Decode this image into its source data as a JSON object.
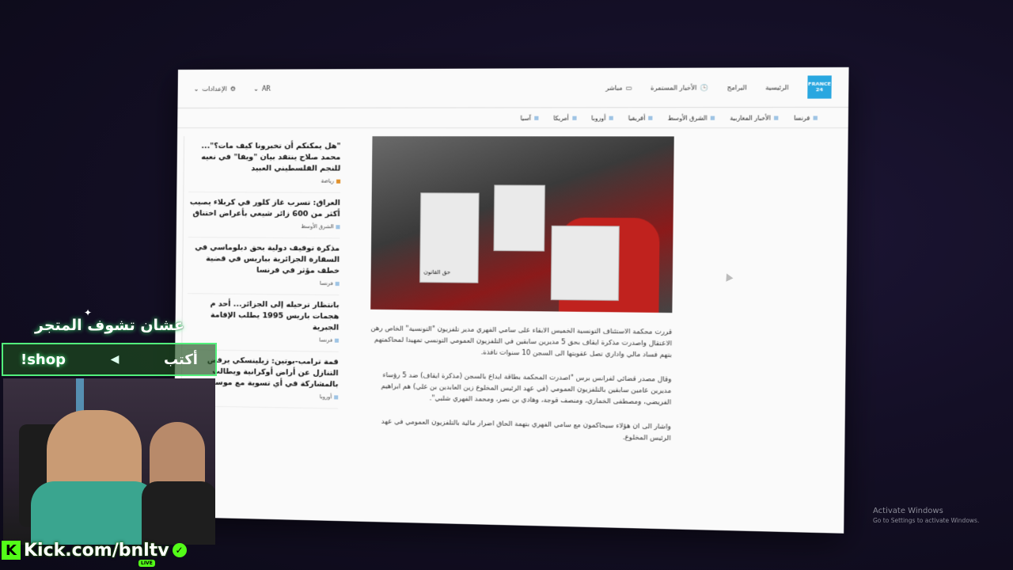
{
  "browser": {
    "header": {
      "logo_text": "FRANCE 24",
      "nav_top": [
        "الرئيسية",
        "البرامج",
        "الأخبار المستمرة",
        "مباشر"
      ],
      "lang": "AR",
      "settings_label": "الإعدادات"
    },
    "nav_sections": [
      "فرنسا",
      "الأخبار المغاربية",
      "الشرق الأوسط",
      "أفريقيا",
      "أوروبا",
      "أمريكا",
      "آسيا"
    ],
    "sidebar": [
      {
        "title": "\"هل يمكنكم أن تخبرونا كيف مات؟\"... محمد صلاح ينتقد بيان \"ويفا\" في نعيه للنجم الفلسطيني العبيد",
        "category": "رياضة"
      },
      {
        "title": "العراق: تسرب غاز كلور في كربلاء يصيب أكثر من 600 زائر شيعي بأعراض اختناق",
        "category": "الشرق الأوسط"
      },
      {
        "title": "مذكرة توقيف دولية بحق دبلوماسي في السفارة الجزائرية بباريس في قضية خطف مؤثر في فرنسا",
        "category": "فرنسا"
      },
      {
        "title": "بانتظار ترحيله إلى الجزائر... أحد م هجمات باريس 1995 يطلب الإقامة الجبرية",
        "category": "فرنسا"
      },
      {
        "title": "قمة ترامب-بوتين: زيلينسكي يرفض التنازل عن أراض أوكرانية ويطالب بالمشاركة في أي تسوية مع موسك",
        "category": "أوروبا"
      }
    ],
    "article": {
      "photo_sign_text": "حق القانون",
      "paragraphs": [
        "قررت محكمة الاستئناف التونسية الخميس الابقاء على سامي الفهري مدير تلفزيون \"التونسية\" الخاص رهن الاعتقال واصدرت مذكرة ايقاف بحق 5 مديرين سابقين في التلفزيون العمومي التونسي تمهيدا لمحاكمتهم بتهم فساد مالي واداري تصل عقوبتها الى السجن 10 سنوات نافذة.",
        "وقال مصدر قضائي لفرانس برس \"اصدرت المحكمة بطاقة ايداع بالسجن (مذكرة ايقاف) ضد 5 رؤساء مديرين عامين سابقين بالتلفزيون العمومي (في عهد الرئيس المخلوع زين العابدين بن علي) هم ابراهيم الفريضي، ومصطفى الخماري، ومنصف قوجة، وهادي بن نصر، ومحمد الفهري شلبي\".",
        "واشار الى ان هؤلاء سيحاكمون مع سامي الفهري بتهمة الحاق اضرار مالية بالتلفزيون العمومي في عهد الرئيس المخلوع."
      ]
    }
  },
  "stream_overlay": {
    "prompt_text": "عشان تشوف المتجر",
    "verb": "أكتب",
    "command": "!shop",
    "kick_url": "Kick.com/bnltv",
    "live_badge": "LIVE"
  },
  "windows_watermark": {
    "line1": "Activate Windows",
    "line2": "Go to Settings to activate Windows."
  },
  "colors": {
    "accent_green": "#53fc18",
    "france24_blue": "#29a7e0"
  }
}
